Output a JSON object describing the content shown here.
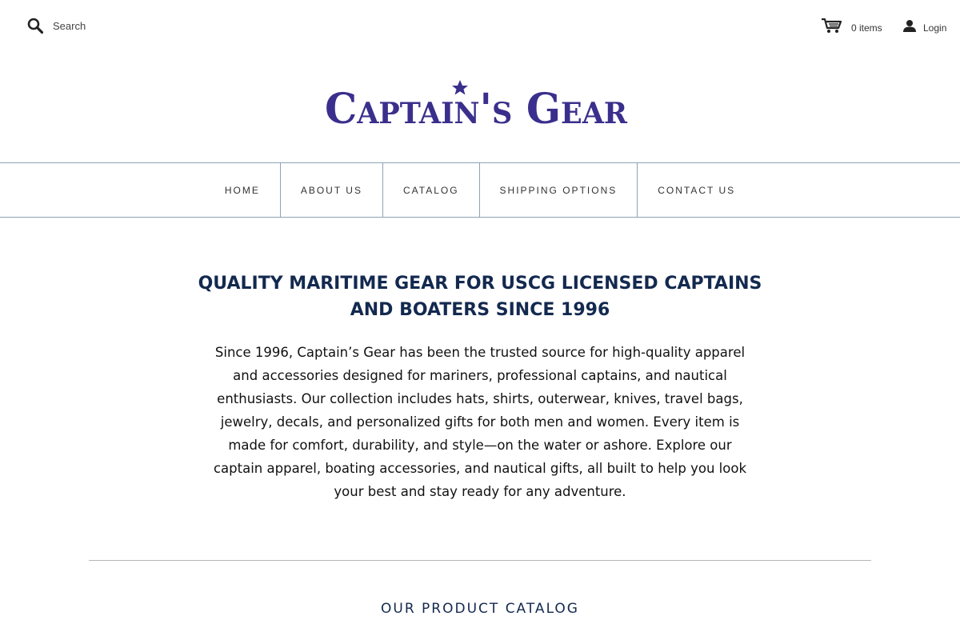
{
  "header": {
    "search": {
      "placeholder": "Search",
      "icon": "search-icon"
    },
    "cart": {
      "count_label": "0 items",
      "icon": "cart-icon"
    },
    "login": {
      "label": "Login",
      "icon": "user-icon"
    }
  },
  "brand": {
    "logo_text": "Captain's Gear",
    "color": "#3a2f8c"
  },
  "nav": {
    "items": [
      {
        "label": "HOME"
      },
      {
        "label": "ABOUT US"
      },
      {
        "label": "CATALOG"
      },
      {
        "label": "SHIPPING OPTIONS"
      },
      {
        "label": "CONTACT US"
      }
    ]
  },
  "hero": {
    "title": "QUALITY MARITIME GEAR FOR USCG LICENSED CAPTAINS AND BOATERS SINCE 1996",
    "body": "Since 1996, Captain’s Gear has been the trusted source for high-quality apparel and accessories designed for mariners, professional captains, and nautical enthusiasts. Our collection includes hats, shirts, outerwear, knives, travel bags, jewelry, decals, and personalized gifts for both men and women. Every item is made for comfort, durability, and style—on the water or ashore. Explore our captain apparel, boating accessories, and nautical gifts, all built to help you look your best and stay ready for any adventure."
  },
  "catalog": {
    "heading": "OUR PRODUCT CATALOG"
  },
  "colors": {
    "accent": "#13294f",
    "nav_border": "#8ea3b5"
  }
}
